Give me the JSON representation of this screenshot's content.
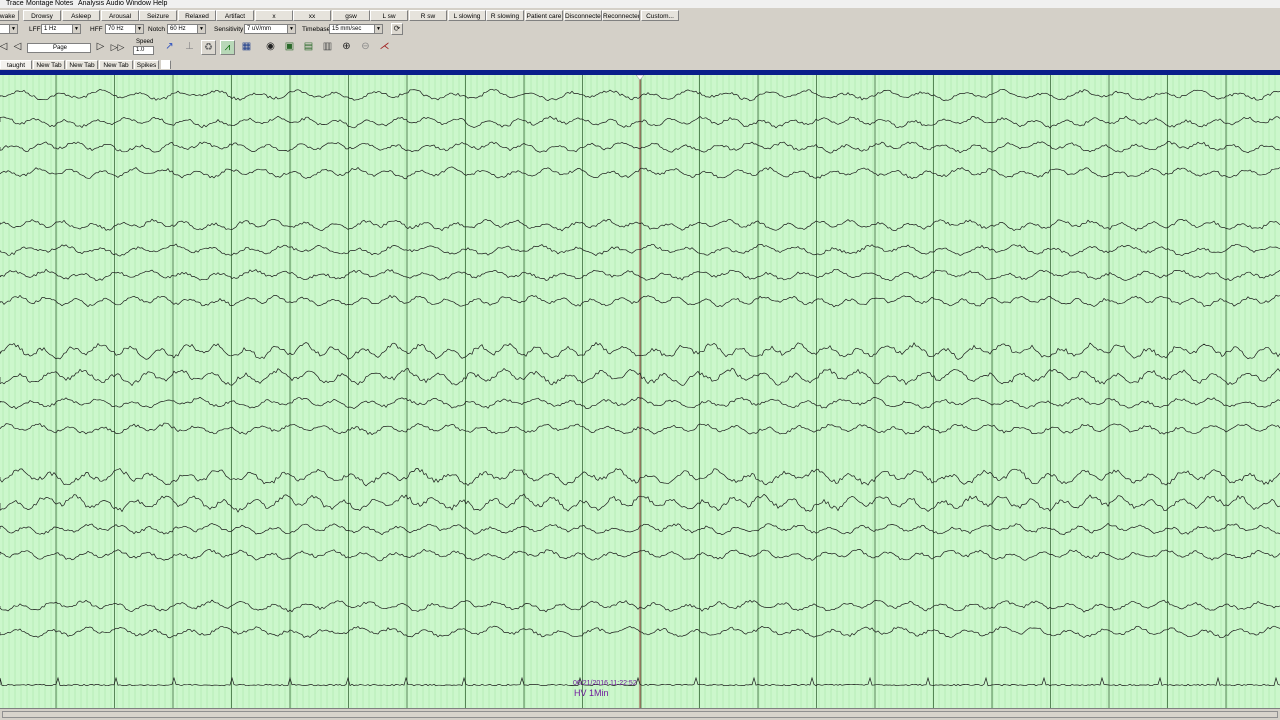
{
  "menu": [
    "Trace",
    "Montage",
    "Notes",
    "Analysis",
    "Audio",
    "Window",
    "Help"
  ],
  "events": [
    "wake",
    "Drowsy",
    "Asleep",
    "Arousal",
    "Seizure",
    "Relaxed",
    "Artifact",
    "x",
    "xx",
    "gsw",
    "L sw",
    "R sw",
    "L slowing",
    "R slowing",
    "Patient care",
    "Disconnected",
    "Reconnected",
    "Custom..."
  ],
  "filters": {
    "lff_label": "LFF",
    "lff_value": "1 Hz",
    "hff_label": "HFF",
    "hff_value": "70 Hz",
    "notch_label": "Notch",
    "notch_value": "60 Hz",
    "sensitivity_label": "Sensitivity",
    "sensitivity_value": "7 uV/mm",
    "timebase_label": "Timebase",
    "timebase_value": "15 mm/sec"
  },
  "toolbar": {
    "page_label": "Page",
    "speed_label": "Speed",
    "speed_value": "1.0"
  },
  "tabs": [
    "taught",
    "New Tab",
    "New Tab",
    "New Tab",
    "Spikes"
  ],
  "annotation": {
    "timestamp": "06/21/2016 11:22:52",
    "note": "HV 1Min"
  },
  "colors": {
    "background": "#ccf7cc",
    "minor_grid": "#a8e8a8",
    "second_line": "#3a6a3a",
    "trace": "#1a1a1a",
    "cursor": "#b06a60",
    "annotation": "#701a9c",
    "top_strip": "#0a1d8a"
  },
  "icons": [
    "prev-page-icon",
    "back-icon",
    "forward-icon",
    "fast-forward-icon",
    "select-icon",
    "measure-icon",
    "spike-icon",
    "montage-icon",
    "video-icon",
    "camera-icon",
    "print-icon",
    "export-icon",
    "settings-icon",
    "zoom-in-icon",
    "zoom-out-icon",
    "marker-icon"
  ]
}
